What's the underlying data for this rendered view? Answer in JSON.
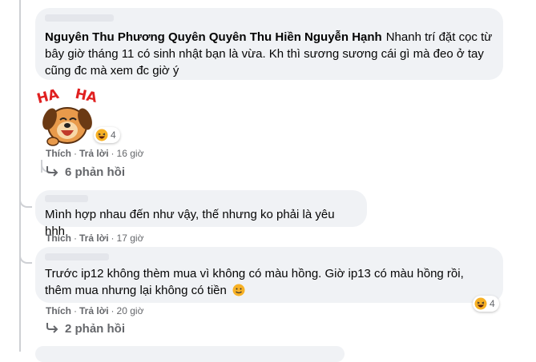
{
  "comments": [
    {
      "author": "Nguyên Thu Phương Quyên Quyên Thu Hiền Nguyễn Hạnh",
      "text": "Nhanh trí đặt cọc từ bây giờ tháng 11 có sinh nhật bạn là vừa. Kh thì sương sương cái gì mà đeo ở tay cũng đc mà xem đc giờ ý",
      "sticker": "haha-dog-sticker",
      "reaction_icon": "haha-icon",
      "reaction_count": "4",
      "like_label": "Thích",
      "reply_label": "Trả lời",
      "time": "16 giờ",
      "replies_label": "6 phản hồi"
    },
    {
      "text": "Mình hợp nhau đến như vậy, thế nhưng ko phải là yêu hhh",
      "like_label": "Thích",
      "reply_label": "Trả lời",
      "time": "17 giờ"
    },
    {
      "text": "Trước ip12 không thèm mua vì không có màu hồng. Giờ ip13 có màu hồng rồi, thêm mua nhưng lại không có tiền",
      "emoji": "slightly-smiling-icon",
      "reaction_icon": "haha-icon",
      "reaction_count": "4",
      "like_label": "Thích",
      "reply_label": "Trả lời",
      "time": "20 giờ",
      "replies_label": "2 phản hồi"
    }
  ],
  "colors": {
    "bubble": "#f0f2f5",
    "meta_text": "#65676b",
    "thread_line": "#ced0d4",
    "reaction_yellow": "#f7b125"
  }
}
